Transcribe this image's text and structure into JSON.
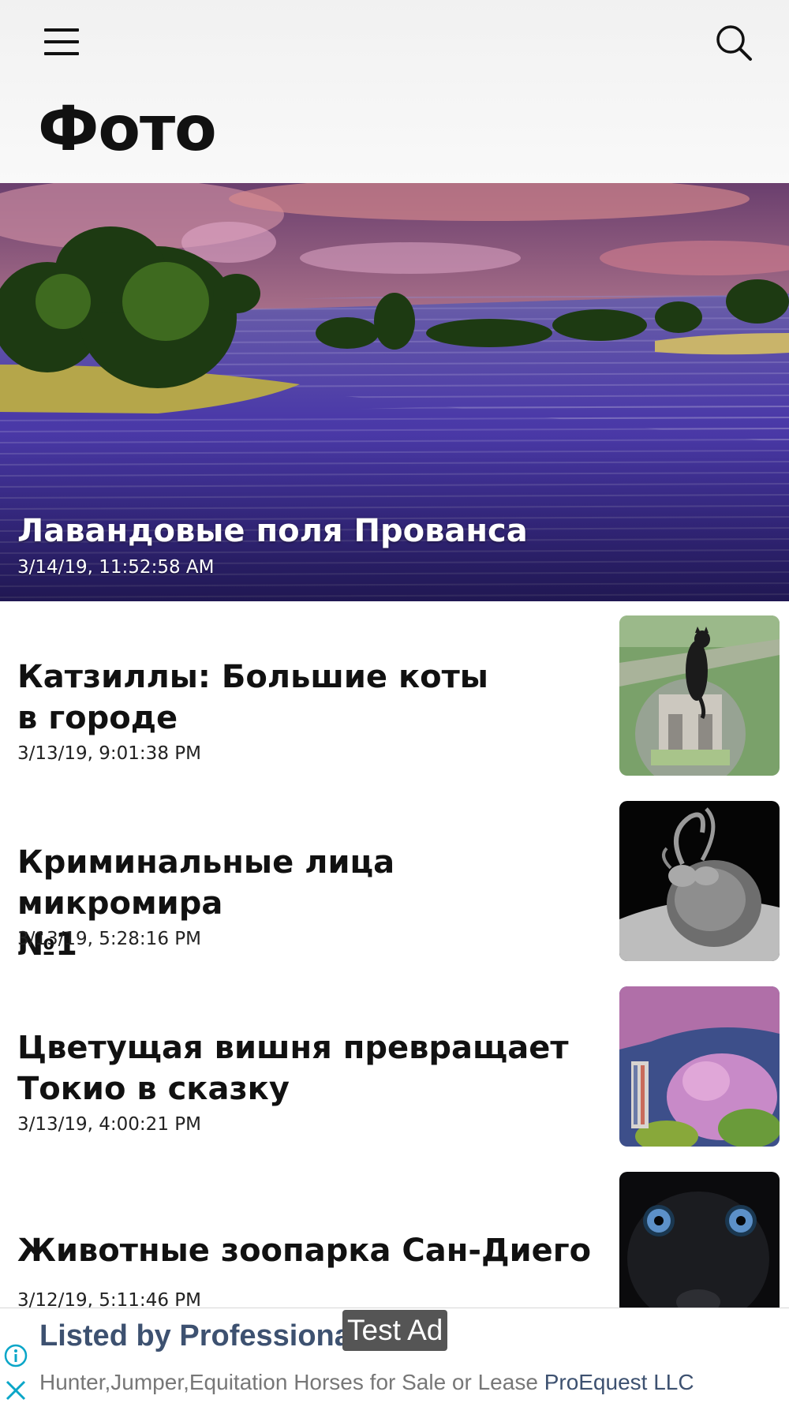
{
  "header": {
    "title": "Фото"
  },
  "featured": {
    "title": "Лавандовые поля Прованса",
    "date": "3/14/19, 11:52:58 AM"
  },
  "articles": [
    {
      "title_line1": "Катзиллы: Большие коты",
      "title_line2": "в городе",
      "date": "3/13/19, 9:01:38 PM"
    },
    {
      "title_line1": "Криминальные лица микромира",
      "title_line2": "№1",
      "date": "3/13/19, 5:28:16 PM"
    },
    {
      "title_line1": "Цветущая вишня превращает",
      "title_line2": "Токио в сказку",
      "date": "3/13/19, 4:00:21 PM"
    },
    {
      "title_line1": "Животные зоопарка Сан-Диего",
      "date": "3/12/19, 5:11:46 PM"
    }
  ],
  "ad": {
    "badge": "Test Ad",
    "headline": "Listed by Professional",
    "body": "Hunter,Jumper,Equitation Horses for Sale or Lease",
    "advertiser": "ProEquest LLC"
  },
  "colors": {
    "ad_text": "#3d5170",
    "ad_icon": "#0aa6c8",
    "hero_lavender": "#4b3aa8"
  }
}
